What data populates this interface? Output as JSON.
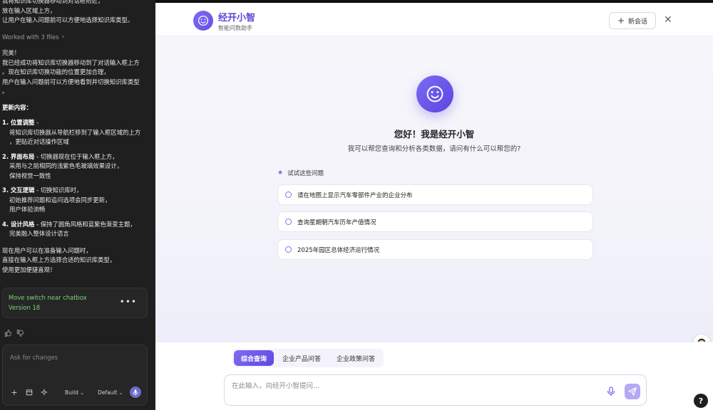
{
  "left_panel": {
    "cut_lines": [
      "我将知识库切换器移动到对话框附近，",
      "放在输入区域上方，",
      "让用户在输入问题前可以方便地选择知识库类型。"
    ],
    "worked_label": "Worked with 3 files",
    "summary_lines": [
      "完美！",
      "我已经成功将知识库切换器移动到了对话输入框上方",
      "。现在知识库切换功能的位置更加合理，",
      "用户在输入问题前可以方便地看到并切换知识库类型",
      "。"
    ],
    "heading": "更新内容：",
    "items": [
      {
        "title_bold": "1. 位置调整",
        "title_rest": " -",
        "sub": [
          "将知识库切换器从导航栏移到了输入框区域的上方",
          "，更贴近对话操作区域"
        ]
      },
      {
        "title_bold": "2. 界面布局",
        "title_rest": " - 切换器现在位于输入框上方，",
        "sub": [
          "采用与之前相同的浅紫色毛玻璃效果设计，",
          "保持视觉一致性"
        ]
      },
      {
        "title_bold": "3. 交互逻辑",
        "title_rest": " - 切换知识库时，",
        "sub": [
          "初始推荐问题和追问选项会同步更新，",
          "用户体验流畅"
        ]
      },
      {
        "title_bold": "4. 设计风格",
        "title_rest": " - 保持了圆角风格和蓝紫色渐变主题，",
        "sub": [
          "完美融入整体设计语言"
        ]
      }
    ],
    "closing_lines": [
      "现在用户可以在准备输入问题时，",
      "直接在输入框上方选择合适的知识库类型，",
      "使用更加便捷直观！"
    ],
    "version": {
      "title": "Move switch near chatbox",
      "label": "Version 18",
      "menu": "•••"
    },
    "chatbox": {
      "placeholder": "Ask for changes",
      "build_label": "Build",
      "default_label": "Default"
    }
  },
  "app": {
    "brand_title": "经开小智",
    "brand_subtitle": "智能问数助手",
    "new_chat_label": "新会话",
    "close_label": "✕",
    "greeting": "您好！我是经开小智",
    "greeting_sub": "我可以帮您查询和分析各类数据，请问有什么可以帮您的?",
    "try_label": "试试这些问题",
    "suggestions": [
      "请在地图上显示汽车零部件产业的企业分布",
      "查询星期朝汽车历年产值情况",
      "2025年园区总体经济运行情况"
    ],
    "tabs": [
      "综合查询",
      "企业产品问答",
      "企业政策问答"
    ],
    "input_placeholder": "在此输入，向经开小智提问...",
    "help_label": "?"
  },
  "colors": {
    "accent": "#6a4fe8",
    "accent_light": "#b5a8f4",
    "version_green": "#7ed47e",
    "left_bg": "#1f1f1f"
  }
}
